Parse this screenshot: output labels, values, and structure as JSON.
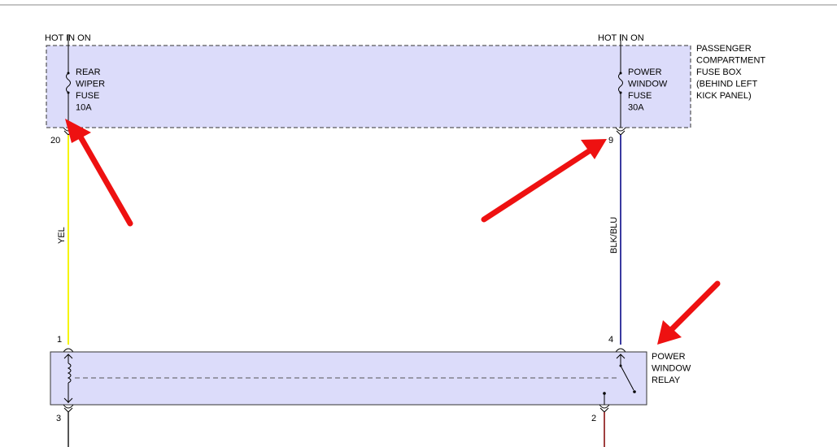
{
  "fuse_box": {
    "hot_in_on_left": "HOT IN ON",
    "hot_in_on_right": "HOT IN ON",
    "name_lines": [
      "PASSENGER",
      "COMPARTMENT",
      "FUSE BOX",
      "(BEHIND LEFT",
      "KICK PANEL)"
    ],
    "rear_wiper_fuse_lines": [
      "REAR",
      "WIPER",
      "FUSE",
      "10A"
    ],
    "power_window_fuse_lines": [
      "POWER",
      "WINDOW",
      "FUSE",
      "30A"
    ],
    "pin_left": "20",
    "pin_right": "9"
  },
  "wires": {
    "left_color_label": "YEL",
    "right_color_label": "BLK/BLU",
    "left_color": "#f5f500",
    "right_color": "#3a3aa0",
    "bottom_left_color": "#555555",
    "bottom_right_color": "#a04040"
  },
  "relay": {
    "name_lines": [
      "POWER",
      "WINDOW",
      "RELAY"
    ],
    "pin_top_left": "1",
    "pin_top_right": "4",
    "pin_bottom_left": "3",
    "pin_bottom_right": "2"
  },
  "colors": {
    "component_fill": "#dcdcfa",
    "arrow": "#ee1111"
  }
}
